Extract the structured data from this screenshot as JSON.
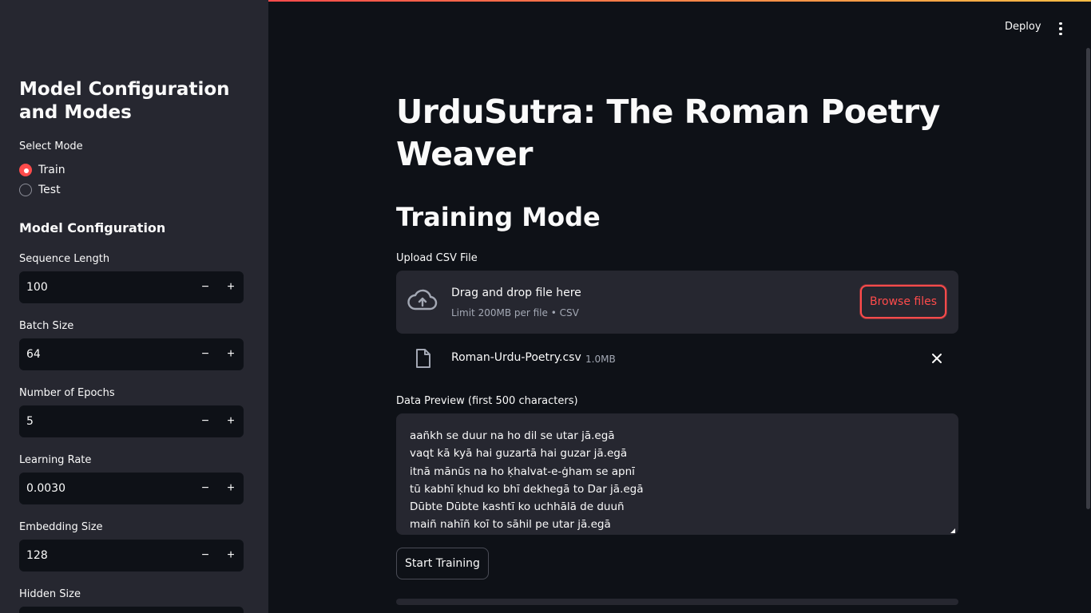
{
  "header": {
    "deploy_label": "Deploy"
  },
  "sidebar": {
    "title": "Model Configuration and Modes",
    "mode_label": "Select Mode",
    "modes": [
      {
        "label": "Train",
        "checked": true
      },
      {
        "label": "Test",
        "checked": false
      }
    ],
    "config_title": "Model Configuration",
    "fields": [
      {
        "label": "Sequence Length",
        "value": "100"
      },
      {
        "label": "Batch Size",
        "value": "64"
      },
      {
        "label": "Number of Epochs",
        "value": "5"
      },
      {
        "label": "Learning Rate",
        "value": "0.0030"
      },
      {
        "label": "Embedding Size",
        "value": "128"
      },
      {
        "label": "Hidden Size",
        "value": ""
      }
    ],
    "step_minus": "−",
    "step_plus": "+"
  },
  "main": {
    "title": "UrduSutra: The Roman Poetry Weaver",
    "section_title": "Training Mode",
    "upload_label": "Upload CSV File",
    "dropzone": {
      "title": "Drag and drop file here",
      "subtitle": "Limit 200MB per file • CSV",
      "browse_label": "Browse files"
    },
    "file": {
      "name": "Roman-Urdu-Poetry.csv",
      "size": "1.0MB"
    },
    "preview_label": "Data Preview (first 500 characters)",
    "preview_lines": [
      "aañkh se duur na ho dil se utar jā.egā",
      "vaqt kā kyā hai guzartā hai guzar jā.egā",
      "itnā mānūs na ho ḳhalvat-e-ġham se apnī",
      "tū kabhī ḳhud ko bhī dekhegā to Dar jā.egā",
      "Dūbte Dūbte kashtī ko uchhālā de duuñ",
      "maiñ nahīñ koī to sāhil pe utar jā.egā"
    ],
    "start_label": "Start Training"
  },
  "colors": {
    "accent": "#ff4b4b",
    "bg": "#0e1117",
    "sidebar_bg": "#262730"
  }
}
